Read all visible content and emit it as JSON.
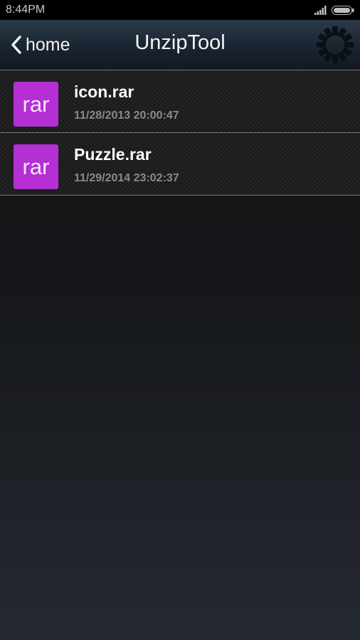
{
  "status_bar": {
    "time": "8:44PM"
  },
  "header": {
    "back_label": "home",
    "title": "UnzipTool"
  },
  "files": [
    {
      "icon_text": "rar",
      "name": "icon.rar",
      "date": "11/28/2013 20:00:47"
    },
    {
      "icon_text": "rar",
      "name": "Puzzle.rar",
      "date": "11/29/2014 23:02:37"
    }
  ],
  "colors": {
    "rar_icon": "#b42fd4",
    "date_text": "#8a8a8a"
  }
}
